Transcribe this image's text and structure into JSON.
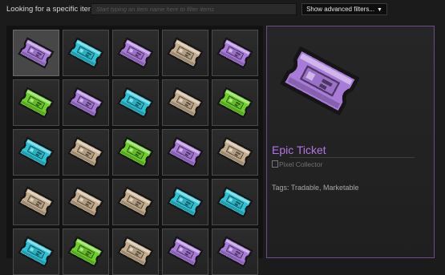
{
  "filter": {
    "label": "Looking for a specific item?",
    "placeholder": "Start typing an item name here to filter items",
    "value": "",
    "advanced_button": "Show advanced filters...",
    "advanced_icon": "chevron-down-icon"
  },
  "colors": {
    "purple": "#a87bd9",
    "cyan": "#2ec2d4",
    "tan": "#c4ad8f",
    "green": "#6ecf2b",
    "detail_border": "#6e4b87",
    "item_name": "#b076e3"
  },
  "inventory": {
    "rows": [
      [
        "purple",
        "cyan",
        "purple",
        "tan",
        "purple"
      ],
      [
        "green",
        "purple",
        "cyan",
        "tan",
        "green"
      ],
      [
        "cyan",
        "tan",
        "green",
        "purple",
        "tan"
      ],
      [
        "tan",
        "tan",
        "tan",
        "cyan",
        "cyan"
      ],
      [
        "cyan",
        "green",
        "tan",
        "purple",
        "purple"
      ]
    ],
    "selected_row": 0,
    "selected_col": 0
  },
  "detail": {
    "image_icon": "ticket-icon",
    "name": "Epic Ticket",
    "game_alt": "Pixel Collector",
    "tags": "Tags: Tradable, Marketable"
  }
}
